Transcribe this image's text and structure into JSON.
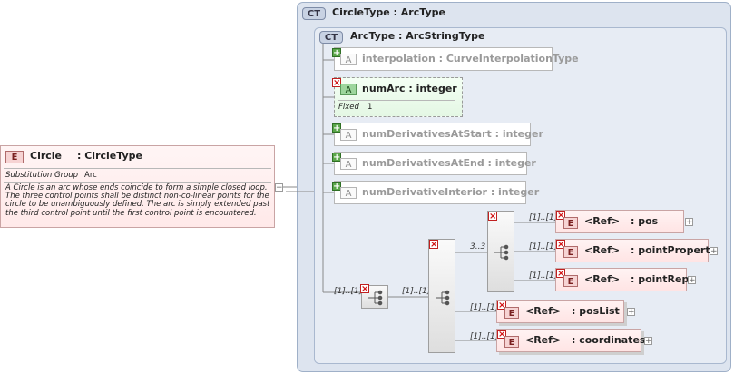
{
  "outer_type": {
    "badge": "CT",
    "title": "CircleType : ArcType"
  },
  "inner_type": {
    "badge": "CT",
    "title": "ArcType : ArcStringType"
  },
  "element": {
    "badge": "E",
    "name": "Circle",
    "type": ": CircleType",
    "subst_label": "Substitution Group",
    "subst_value": "Arc",
    "description": "A Circle is an arc whose ends coincide to form a simple closed loop. The three control points shall be distinct non-co-linear points for the circle to be unambiguously defined. The arc is simply extended past the third control point until the first control point is encountered."
  },
  "attributes": [
    {
      "badge": "A",
      "label": "interpolation : CurveInterpolationType"
    },
    {
      "badge": "A",
      "label": "numDerivativesAtStart : integer"
    },
    {
      "badge": "A",
      "label": "numDerivativesAtEnd : integer"
    },
    {
      "badge": "A",
      "label": "numDerivativeInterior : integer"
    }
  ],
  "fixed_attribute": {
    "badge": "A",
    "label": "numArc  : integer",
    "fixed_label": "Fixed",
    "fixed_value": "1"
  },
  "multiplicities": {
    "seq_outer": "[1]..[1]",
    "choice_in": "[1]..[1]",
    "seq_inner": "3..3"
  },
  "refs": [
    {
      "badge": "E",
      "tag": "<Ref>",
      "name": ": pos",
      "mult": "[1]..[1]"
    },
    {
      "badge": "E",
      "tag": "<Ref>",
      "name": ": pointProperty",
      "mult": "[1]..[1]"
    },
    {
      "badge": "E",
      "tag": "<Ref>",
      "name": ": pointRep",
      "mult": "[1]..[1]"
    },
    {
      "badge": "E",
      "tag": "<Ref>",
      "name": ": posList",
      "mult": "[1]..[1]"
    },
    {
      "badge": "E",
      "tag": "<Ref>",
      "name": ": coordinates",
      "mult": "[1]..[1]"
    }
  ],
  "icons": {
    "expand": "+",
    "add": "+",
    "remove": "×"
  }
}
